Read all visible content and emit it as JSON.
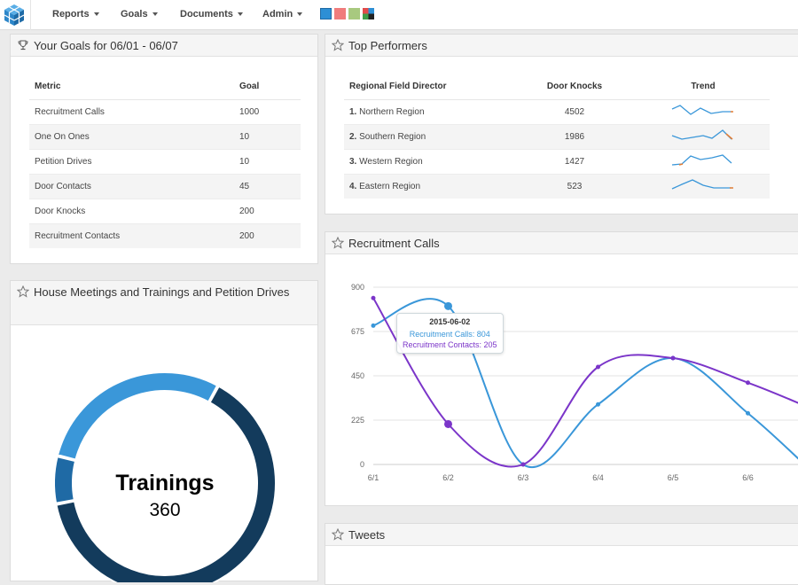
{
  "nav": {
    "items": [
      {
        "label": "Reports"
      },
      {
        "label": "Goals"
      },
      {
        "label": "Documents"
      },
      {
        "label": "Admin"
      }
    ],
    "swatches": [
      "#2d8fd5",
      "#f07c7c",
      "#a8c97f",
      "mixed"
    ]
  },
  "goals": {
    "title": "Your Goals for 06/01 - 06/07",
    "headers": {
      "metric": "Metric",
      "goal": "Goal"
    },
    "rows": [
      {
        "metric": "Recruitment Calls",
        "goal": "1000"
      },
      {
        "metric": "One On Ones",
        "goal": "10"
      },
      {
        "metric": "Petition Drives",
        "goal": "10"
      },
      {
        "metric": "Door Contacts",
        "goal": "45"
      },
      {
        "metric": "Door Knocks",
        "goal": "200"
      },
      {
        "metric": "Recruitment Contacts",
        "goal": "200"
      }
    ]
  },
  "performers": {
    "title": "Top Performers",
    "headers": {
      "director": "Regional Field Director",
      "knocks": "Door Knocks",
      "trend": "Trend"
    },
    "rows": [
      {
        "rank": "1.",
        "name": "Northern Region",
        "knocks": "4502"
      },
      {
        "rank": "2.",
        "name": "Southern Region",
        "knocks": "1986"
      },
      {
        "rank": "3.",
        "name": "Western Region",
        "knocks": "1427"
      },
      {
        "rank": "4.",
        "name": "Eastern Region",
        "knocks": "523"
      }
    ]
  },
  "donut": {
    "title": "House Meetings and Trainings and Petition Drives",
    "center_label": "Trainings",
    "center_value": "360",
    "segments": [
      {
        "value": 0.64,
        "color": "#133b5c"
      },
      {
        "value": 0.07,
        "color": "#1f6aa5"
      },
      {
        "value": 0.29,
        "color": "#3a97d9"
      }
    ]
  },
  "recruitment": {
    "title": "Recruitment Calls",
    "tooltip": {
      "date": "2015-06-02",
      "line1": "Recruitment Calls: 804",
      "line2": "Recruitment Contacts: 205"
    }
  },
  "tweets": {
    "title": "Tweets"
  },
  "chart_data": {
    "type": "line",
    "title": "",
    "xlabel": "",
    "ylabel": "",
    "categories": [
      "6/1",
      "6/2",
      "6/3",
      "6/4",
      "6/5",
      "6/6"
    ],
    "ylim": [
      0,
      900
    ],
    "yticks": [
      "900",
      "675",
      "450",
      "225",
      "0"
    ],
    "series": [
      {
        "name": "Recruitment Calls",
        "color": "#3a97d9",
        "values": [
          705,
          804,
          0,
          305,
          540,
          260
        ]
      },
      {
        "name": "Recruitment Contacts",
        "color": "#7b35c9",
        "values": [
          845,
          205,
          0,
          495,
          540,
          415
        ]
      }
    ],
    "grid": true
  }
}
